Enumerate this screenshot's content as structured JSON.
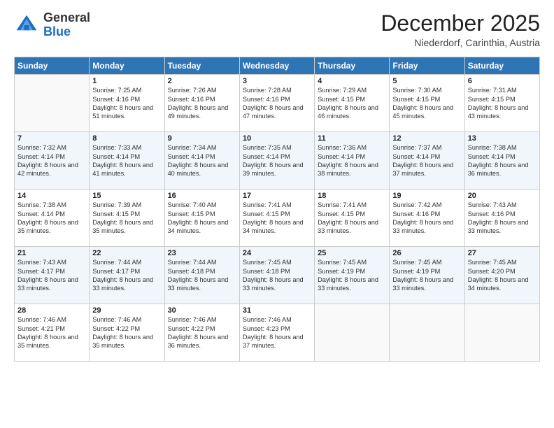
{
  "header": {
    "logo_general": "General",
    "logo_blue": "Blue",
    "month": "December 2025",
    "location": "Niederdorf, Carinthia, Austria"
  },
  "weekdays": [
    "Sunday",
    "Monday",
    "Tuesday",
    "Wednesday",
    "Thursday",
    "Friday",
    "Saturday"
  ],
  "weeks": [
    [
      {
        "day": "",
        "info": ""
      },
      {
        "day": "1",
        "info": "Sunrise: 7:25 AM\nSunset: 4:16 PM\nDaylight: 8 hours\nand 51 minutes."
      },
      {
        "day": "2",
        "info": "Sunrise: 7:26 AM\nSunset: 4:16 PM\nDaylight: 8 hours\nand 49 minutes."
      },
      {
        "day": "3",
        "info": "Sunrise: 7:28 AM\nSunset: 4:16 PM\nDaylight: 8 hours\nand 47 minutes."
      },
      {
        "day": "4",
        "info": "Sunrise: 7:29 AM\nSunset: 4:15 PM\nDaylight: 8 hours\nand 46 minutes."
      },
      {
        "day": "5",
        "info": "Sunrise: 7:30 AM\nSunset: 4:15 PM\nDaylight: 8 hours\nand 45 minutes."
      },
      {
        "day": "6",
        "info": "Sunrise: 7:31 AM\nSunset: 4:15 PM\nDaylight: 8 hours\nand 43 minutes."
      }
    ],
    [
      {
        "day": "7",
        "info": "Sunrise: 7:32 AM\nSunset: 4:14 PM\nDaylight: 8 hours\nand 42 minutes."
      },
      {
        "day": "8",
        "info": "Sunrise: 7:33 AM\nSunset: 4:14 PM\nDaylight: 8 hours\nand 41 minutes."
      },
      {
        "day": "9",
        "info": "Sunrise: 7:34 AM\nSunset: 4:14 PM\nDaylight: 8 hours\nand 40 minutes."
      },
      {
        "day": "10",
        "info": "Sunrise: 7:35 AM\nSunset: 4:14 PM\nDaylight: 8 hours\nand 39 minutes."
      },
      {
        "day": "11",
        "info": "Sunrise: 7:36 AM\nSunset: 4:14 PM\nDaylight: 8 hours\nand 38 minutes."
      },
      {
        "day": "12",
        "info": "Sunrise: 7:37 AM\nSunset: 4:14 PM\nDaylight: 8 hours\nand 37 minutes."
      },
      {
        "day": "13",
        "info": "Sunrise: 7:38 AM\nSunset: 4:14 PM\nDaylight: 8 hours\nand 36 minutes."
      }
    ],
    [
      {
        "day": "14",
        "info": "Sunrise: 7:38 AM\nSunset: 4:14 PM\nDaylight: 8 hours\nand 35 minutes."
      },
      {
        "day": "15",
        "info": "Sunrise: 7:39 AM\nSunset: 4:15 PM\nDaylight: 8 hours\nand 35 minutes."
      },
      {
        "day": "16",
        "info": "Sunrise: 7:40 AM\nSunset: 4:15 PM\nDaylight: 8 hours\nand 34 minutes."
      },
      {
        "day": "17",
        "info": "Sunrise: 7:41 AM\nSunset: 4:15 PM\nDaylight: 8 hours\nand 34 minutes."
      },
      {
        "day": "18",
        "info": "Sunrise: 7:41 AM\nSunset: 4:15 PM\nDaylight: 8 hours\nand 33 minutes."
      },
      {
        "day": "19",
        "info": "Sunrise: 7:42 AM\nSunset: 4:16 PM\nDaylight: 8 hours\nand 33 minutes."
      },
      {
        "day": "20",
        "info": "Sunrise: 7:43 AM\nSunset: 4:16 PM\nDaylight: 8 hours\nand 33 minutes."
      }
    ],
    [
      {
        "day": "21",
        "info": "Sunrise: 7:43 AM\nSunset: 4:17 PM\nDaylight: 8 hours\nand 33 minutes."
      },
      {
        "day": "22",
        "info": "Sunrise: 7:44 AM\nSunset: 4:17 PM\nDaylight: 8 hours\nand 33 minutes."
      },
      {
        "day": "23",
        "info": "Sunrise: 7:44 AM\nSunset: 4:18 PM\nDaylight: 8 hours\nand 33 minutes."
      },
      {
        "day": "24",
        "info": "Sunrise: 7:45 AM\nSunset: 4:18 PM\nDaylight: 8 hours\nand 33 minutes."
      },
      {
        "day": "25",
        "info": "Sunrise: 7:45 AM\nSunset: 4:19 PM\nDaylight: 8 hours\nand 33 minutes."
      },
      {
        "day": "26",
        "info": "Sunrise: 7:45 AM\nSunset: 4:19 PM\nDaylight: 8 hours\nand 33 minutes."
      },
      {
        "day": "27",
        "info": "Sunrise: 7:45 AM\nSunset: 4:20 PM\nDaylight: 8 hours\nand 34 minutes."
      }
    ],
    [
      {
        "day": "28",
        "info": "Sunrise: 7:46 AM\nSunset: 4:21 PM\nDaylight: 8 hours\nand 35 minutes."
      },
      {
        "day": "29",
        "info": "Sunrise: 7:46 AM\nSunset: 4:22 PM\nDaylight: 8 hours\nand 35 minutes."
      },
      {
        "day": "30",
        "info": "Sunrise: 7:46 AM\nSunset: 4:22 PM\nDaylight: 8 hours\nand 36 minutes."
      },
      {
        "day": "31",
        "info": "Sunrise: 7:46 AM\nSunset: 4:23 PM\nDaylight: 8 hours\nand 37 minutes."
      },
      {
        "day": "",
        "info": ""
      },
      {
        "day": "",
        "info": ""
      },
      {
        "day": "",
        "info": ""
      }
    ]
  ]
}
